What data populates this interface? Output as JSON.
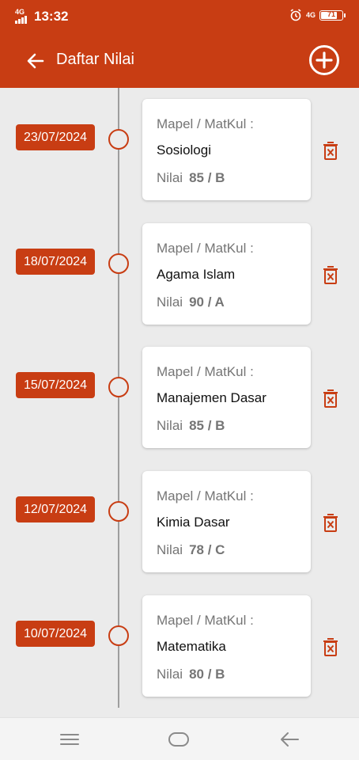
{
  "status": {
    "network": "4G",
    "time": "13:32",
    "network_right": "4G",
    "battery": "71",
    "battery_level": 0.71
  },
  "appbar": {
    "title": "Daftar Nilai",
    "back_icon": "arrow-left-icon",
    "add_icon": "add-circle-icon"
  },
  "list": {
    "label": "Mapel / MatKul :",
    "grade_prefix": "Nilai",
    "items": [
      {
        "date": "23/07/2024",
        "subject": "Sosiologi",
        "grade": "85 / B"
      },
      {
        "date": "18/07/2024",
        "subject": "Agama Islam",
        "grade": "90 / A"
      },
      {
        "date": "15/07/2024",
        "subject": "Manajemen Dasar",
        "grade": "85 / B"
      },
      {
        "date": "12/07/2024",
        "subject": "Kimia Dasar",
        "grade": "78 / C"
      },
      {
        "date": "10/07/2024",
        "subject": "Matematika",
        "grade": "80 / B"
      }
    ]
  },
  "colors": {
    "primary": "#c83d13",
    "background": "#ebebeb",
    "card": "#ffffff",
    "muted_text": "#757575"
  },
  "navbar": {
    "menu_icon": "menu-icon",
    "home_icon": "home-icon",
    "back_icon": "back-icon"
  }
}
